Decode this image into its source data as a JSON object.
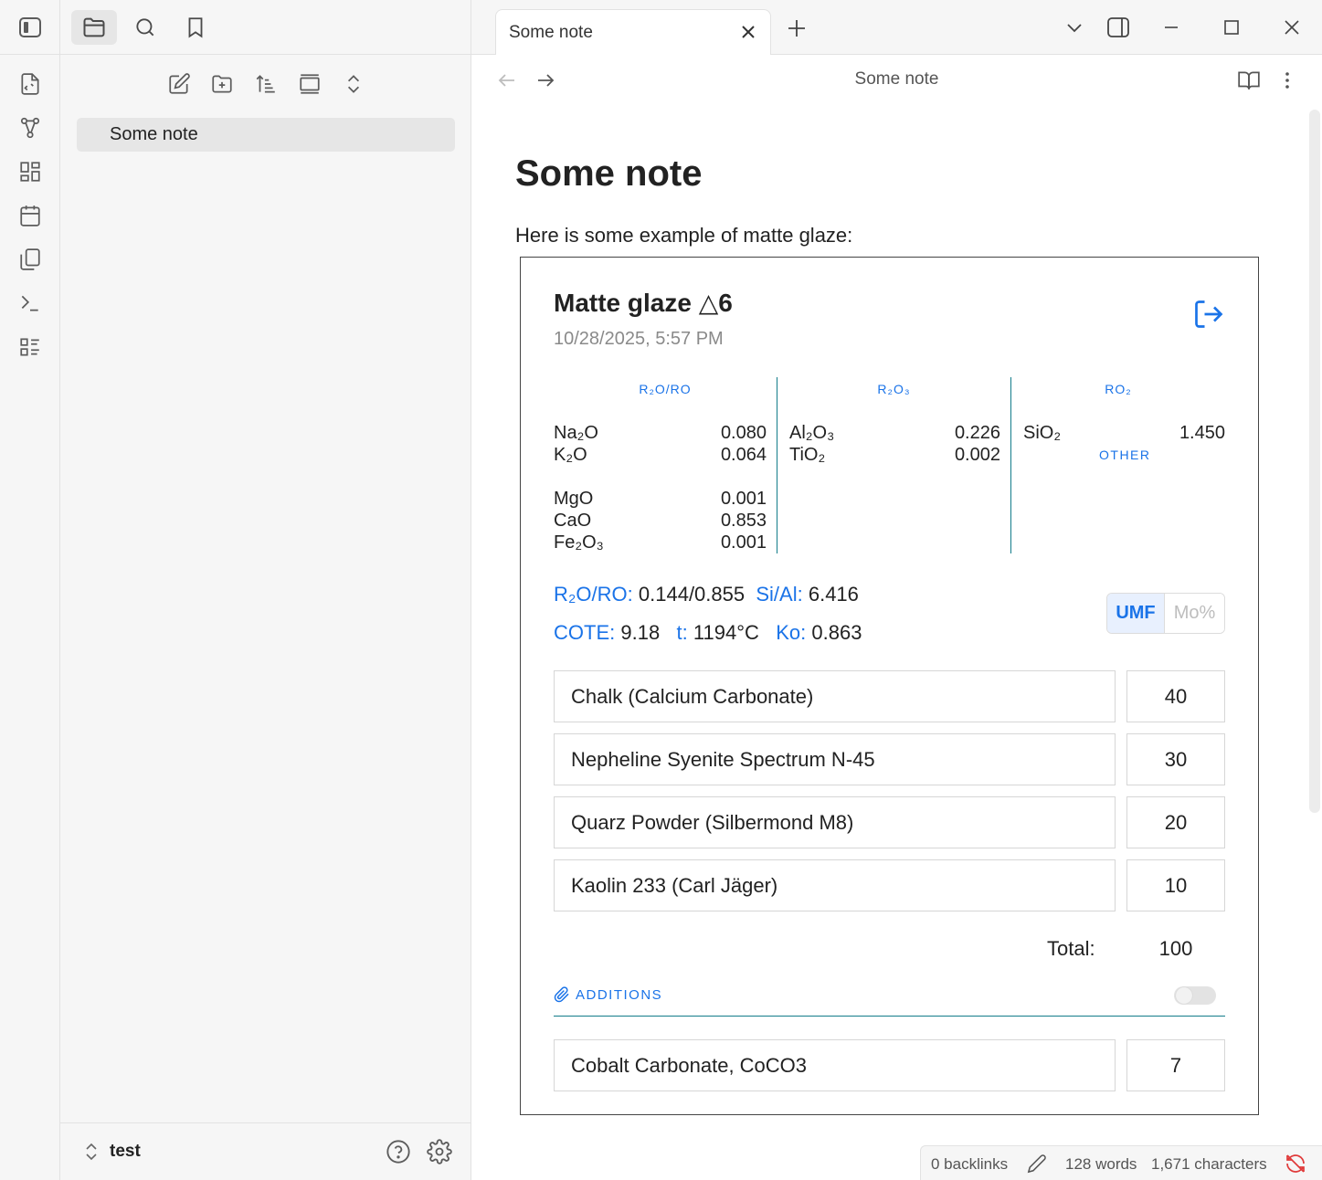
{
  "tab": {
    "title": "Some note"
  },
  "view_header": {
    "title": "Some note"
  },
  "sidebar": {
    "files": [
      "Some note"
    ],
    "vault": "test"
  },
  "note": {
    "title": "Some note",
    "paragraph": "Here is some example of matte glaze:"
  },
  "glaze": {
    "title": "Matte glaze △6",
    "date": "10/28/2025, 5:57 PM",
    "columns": {
      "r2o_ro": {
        "header": "R₂O/RO",
        "rows": [
          {
            "name": "Na₂O",
            "value": "0.080"
          },
          {
            "name": "K₂O",
            "value": "0.064"
          },
          {
            "name": "MgO",
            "value": "0.001"
          },
          {
            "name": "CaO",
            "value": "0.853"
          },
          {
            "name": "Fe₂O₃",
            "value": "0.001"
          }
        ]
      },
      "r2o3": {
        "header": "R₂O₃",
        "rows": [
          {
            "name": "Al₂O₃",
            "value": "0.226"
          },
          {
            "name": "TiO₂",
            "value": "0.002"
          }
        ]
      },
      "ro2": {
        "header": "RO₂",
        "rows": [
          {
            "name": "SiO₂",
            "value": "1.450"
          }
        ],
        "other_label": "OTHER"
      }
    },
    "stats": {
      "r2o_ro_label": "R₂O/RO:",
      "r2o_ro_value": "0.144/0.855",
      "si_al_label": "Si/Al:",
      "si_al_value": "6.416",
      "cote_label": "COTE:",
      "cote_value": "9.18",
      "t_label": "t:",
      "t_value": "1194°C",
      "ko_label": "Ko:",
      "ko_value": "0.863"
    },
    "mode_toggle": {
      "umf": "UMF",
      "mo": "Mo%"
    },
    "materials": [
      {
        "name": "Chalk (Calcium Carbonate)",
        "amount": "40"
      },
      {
        "name": "Nepheline Syenite Spectrum N-45",
        "amount": "30"
      },
      {
        "name": "Quarz Powder (Silbermond M8)",
        "amount": "20"
      },
      {
        "name": "Kaolin 233 (Carl Jäger)",
        "amount": "10"
      }
    ],
    "total_label": "Total:",
    "total_value": "100",
    "additions_label": "ADDITIONS",
    "additions": [
      {
        "name": "Cobalt Carbonate, CoCO3",
        "amount": "7"
      }
    ]
  },
  "status": {
    "backlinks": "0 backlinks",
    "words": "128 words",
    "characters": "1,671 characters"
  },
  "colors": {
    "accent": "#1a73e8",
    "divider": "#137c8a"
  }
}
